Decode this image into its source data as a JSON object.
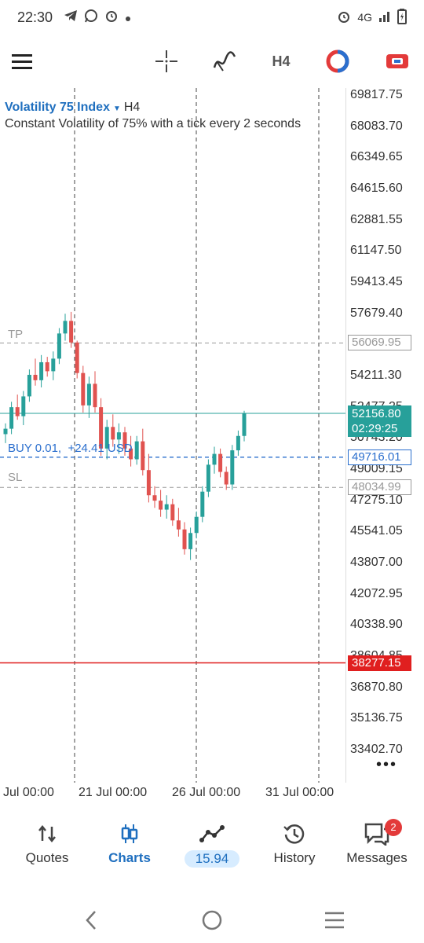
{
  "status_bar": {
    "time": "22:30",
    "network": "4G",
    "left_icons": [
      "telegram-icon",
      "whatsapp-icon",
      "alarm-icon",
      "dot-icon"
    ],
    "right_icons": [
      "alarm-icon",
      "signal-icon",
      "battery-icon"
    ]
  },
  "toolbar": {
    "timeframe": "H4",
    "icons": [
      "menu-icon",
      "crosshair-icon",
      "indicators-icon",
      "one-click-trading-icon",
      "trade-icon"
    ]
  },
  "chart_header": {
    "symbol": "Volatility 75 Index",
    "timeframe": "H4",
    "description": "Constant Volatility of 75% with a tick every 2 seconds"
  },
  "chart_data": {
    "type": "candlestick",
    "price_ticks": [
      "69817.75",
      "68083.70",
      "66349.65",
      "64615.60",
      "62881.55",
      "61147.50",
      "59413.45",
      "57679.40",
      "55945.35",
      "54211.30",
      "52477.25",
      "50743.20",
      "49009.15",
      "47275.10",
      "45541.05",
      "43807.00",
      "42072.95",
      "40338.90",
      "38604.85",
      "36870.80",
      "35136.75",
      "33402.70"
    ],
    "time_labels": [
      "Jul 00:00",
      "21 Jul 00:00",
      "26 Jul 00:00",
      "31 Jul 00:00"
    ],
    "ylim": [
      33402.7,
      69817.75
    ],
    "lines": {
      "tp": {
        "label": "TP",
        "price": "56069.95"
      },
      "sl": {
        "label": "SL",
        "price": "48034.99"
      },
      "buy": {
        "label": "BUY 0.01,",
        "profit": "+24.41 USD",
        "price": "49716.01"
      },
      "bid": {
        "price": "52156.80",
        "countdown": "02:29:25"
      },
      "red_level": {
        "price": "38277.15"
      }
    },
    "candles": [
      [
        51000,
        51600,
        50500,
        51300
      ],
      [
        51300,
        52800,
        51000,
        52500
      ],
      [
        52500,
        53200,
        51800,
        52000
      ],
      [
        52000,
        53400,
        51500,
        53100
      ],
      [
        53100,
        54600,
        52800,
        54300
      ],
      [
        54300,
        55200,
        53700,
        54000
      ],
      [
        54000,
        55400,
        53600,
        55000
      ],
      [
        55000,
        55300,
        54200,
        54500
      ],
      [
        54500,
        55600,
        54000,
        55200
      ],
      [
        55200,
        56900,
        54900,
        56600
      ],
      [
        56600,
        57700,
        56200,
        57300
      ],
      [
        57300,
        57800,
        55800,
        56100
      ],
      [
        56100,
        56200,
        54100,
        54400
      ],
      [
        54400,
        54800,
        52200,
        52600
      ],
      [
        52600,
        54200,
        51900,
        53800
      ],
      [
        53800,
        54500,
        52200,
        52500
      ],
      [
        52500,
        53000,
        49800,
        50200
      ],
      [
        50200,
        51800,
        49600,
        51400
      ],
      [
        51400,
        52100,
        50300,
        50700
      ],
      [
        50700,
        51600,
        49900,
        51100
      ],
      [
        51100,
        51400,
        49800,
        50200
      ],
      [
        50200,
        50900,
        49200,
        49600
      ],
      [
        49600,
        50900,
        49300,
        50600
      ],
      [
        50600,
        51300,
        48700,
        49000
      ],
      [
        49000,
        49900,
        47200,
        47600
      ],
      [
        47600,
        48100,
        46900,
        47300
      ],
      [
        47300,
        47900,
        46400,
        46800
      ],
      [
        46800,
        47600,
        46300,
        47100
      ],
      [
        47100,
        47400,
        45900,
        46200
      ],
      [
        46200,
        46900,
        45300,
        45700
      ],
      [
        45700,
        46100,
        44300,
        44600
      ],
      [
        44600,
        45800,
        44000,
        45500
      ],
      [
        45500,
        46700,
        45200,
        46400
      ],
      [
        46400,
        48100,
        46100,
        47800
      ],
      [
        47800,
        49600,
        47500,
        49300
      ],
      [
        49300,
        50300,
        48800,
        49900
      ],
      [
        49900,
        50200,
        48600,
        48900
      ],
      [
        48900,
        49200,
        47900,
        48200
      ],
      [
        48200,
        50400,
        47900,
        50100
      ],
      [
        50100,
        51200,
        49800,
        50900
      ],
      [
        50900,
        52300,
        50600,
        52156
      ]
    ]
  },
  "bottom_nav": [
    {
      "label": "Quotes",
      "icon": "quotes-arrows-icon",
      "active": false
    },
    {
      "label": "Charts",
      "icon": "charts-candles-icon",
      "active": true
    },
    {
      "label": "15.94",
      "icon": "trade-graph-icon",
      "active": false
    },
    {
      "label": "History",
      "icon": "history-clock-icon",
      "active": false
    },
    {
      "label": "Messages",
      "icon": "messages-icon",
      "active": false,
      "badge": "2"
    }
  ],
  "colors": {
    "accent": "#1f6fbf",
    "bull": "#27a09a",
    "bear": "#e0524f",
    "tp_sl": "#999999",
    "buy": "#2b6fce",
    "red_level": "#e01f1f"
  }
}
